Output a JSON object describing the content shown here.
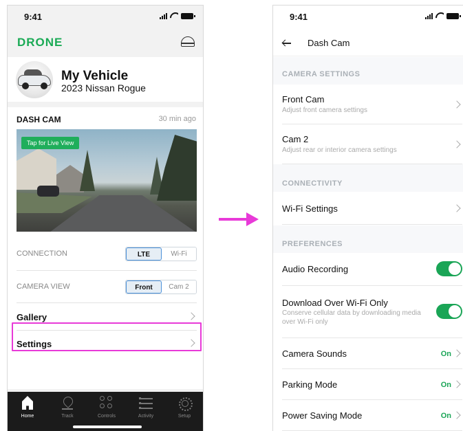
{
  "screen1": {
    "status_time": "9:41",
    "brand": "DRONE",
    "vehicle": {
      "name": "My Vehicle",
      "model": "2023 Nissan Rogue"
    },
    "dashcam": {
      "title": "DASH CAM",
      "updated": "30 min ago",
      "live_badge": "Tap for Live View",
      "connection": {
        "label": "CONNECTION",
        "options": [
          "LTE",
          "Wi-Fi"
        ],
        "selected": "LTE"
      },
      "camera_view": {
        "label": "CAMERA VIEW",
        "options": [
          "Front",
          "Cam 2"
        ],
        "selected": "Front"
      },
      "gallery_label": "Gallery",
      "settings_label": "Settings"
    },
    "tabs": [
      {
        "label": "Home",
        "icon": "home-icon",
        "active": true
      },
      {
        "label": "Track",
        "icon": "location-pin-icon",
        "active": false
      },
      {
        "label": "Controls",
        "icon": "controls-icon",
        "active": false
      },
      {
        "label": "Activity",
        "icon": "list-icon",
        "active": false
      },
      {
        "label": "Setup",
        "icon": "gear-icon",
        "active": false
      }
    ],
    "highlight_color": "#e83ad8",
    "brand_color": "#1aaa55"
  },
  "screen2": {
    "status_time": "9:41",
    "title": "Dash Cam",
    "camera_settings": {
      "heading": "CAMERA SETTINGS",
      "items": [
        {
          "title": "Front Cam",
          "subtitle": "Adjust front camera settings"
        },
        {
          "title": "Cam 2",
          "subtitle": "Adjust rear or interior camera settings"
        }
      ]
    },
    "connectivity": {
      "heading": "CONNECTIVITY",
      "items": [
        {
          "title": "Wi-Fi Settings"
        }
      ]
    },
    "preferences": {
      "heading": "PREFERENCES",
      "audio_recording": {
        "title": "Audio Recording",
        "enabled": true
      },
      "download_wifi": {
        "title": "Download Over Wi-Fi Only",
        "subtitle": "Conserve cellular data by downloading media over Wi-Fi only",
        "enabled": true
      },
      "camera_sounds": {
        "title": "Camera Sounds",
        "value": "On"
      },
      "parking_mode": {
        "title": "Parking Mode",
        "value": "On"
      },
      "power_saving": {
        "title": "Power Saving Mode",
        "value": "On"
      }
    },
    "toggle_color": "#1aa556"
  }
}
